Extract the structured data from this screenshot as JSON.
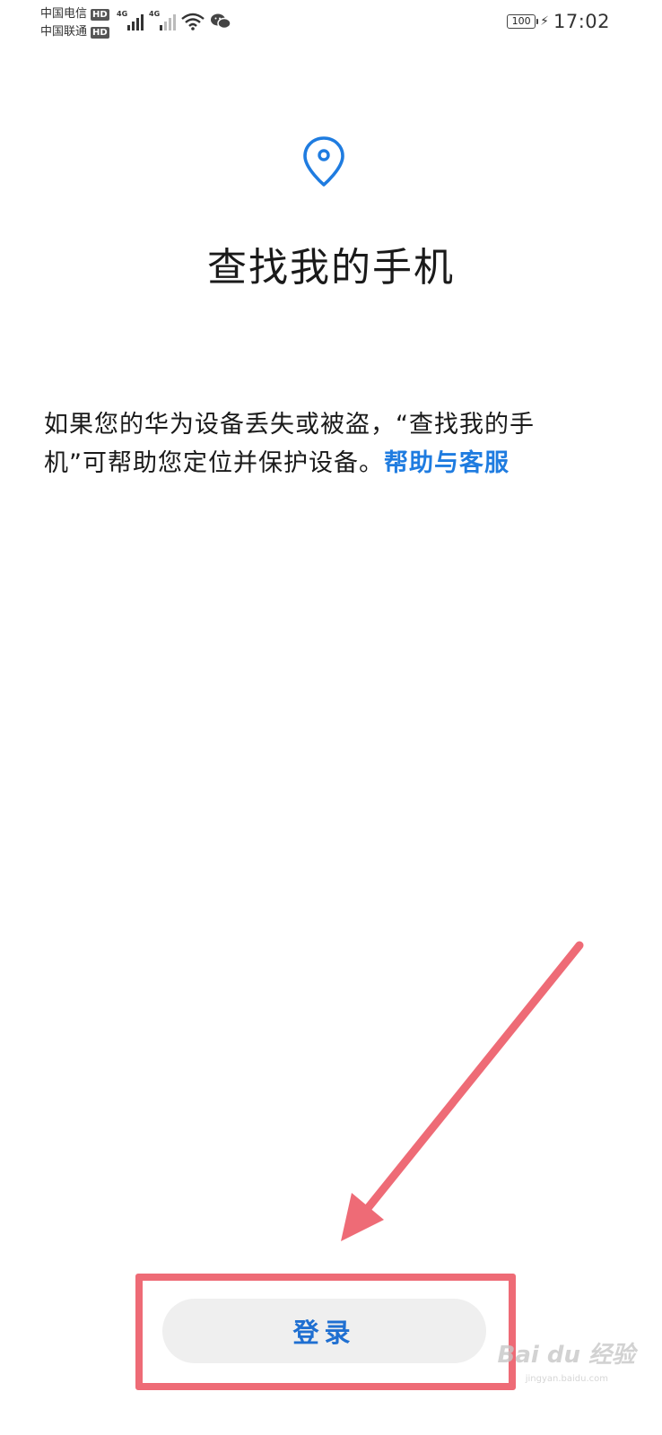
{
  "status_bar": {
    "carrier_1": "中国电信",
    "carrier_2": "中国联通",
    "hd_badge": "HD",
    "network_label": "4G",
    "battery": "100",
    "time": "17:02",
    "icons": [
      "signal-icon",
      "wifi-icon",
      "wechat-icon",
      "battery-icon",
      "charging-icon"
    ]
  },
  "main": {
    "icon": "location-pin-icon",
    "title": "查找我的手机",
    "description": "如果您的华为设备丢失或被盗，“查找我的手机”可帮助您定位并保护设备。",
    "help_link": "帮助与客服"
  },
  "footer": {
    "login_button": "登录"
  },
  "watermark": {
    "text": "Bai du 经验",
    "sub": "jingyan.baidu.com"
  },
  "colors": {
    "accent": "#1f7ce0",
    "annotation": "#ee6b76",
    "button_bg": "#efefef"
  }
}
